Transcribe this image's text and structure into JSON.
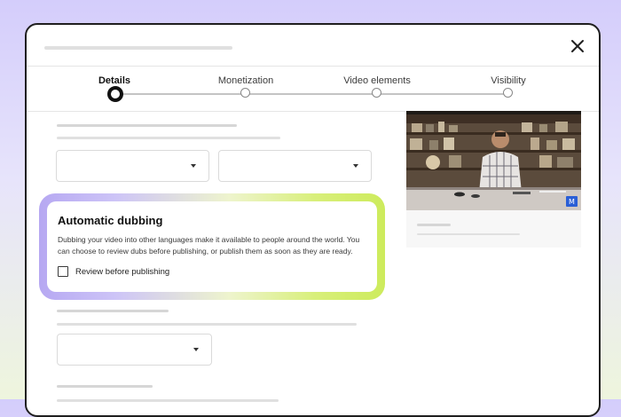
{
  "stepper": {
    "steps": [
      {
        "label": "Details",
        "active": true
      },
      {
        "label": "Monetization",
        "active": false
      },
      {
        "label": "Video elements",
        "active": false
      },
      {
        "label": "Visibility",
        "active": false
      }
    ]
  },
  "dubbing": {
    "title": "Automatic dubbing",
    "description": "Dubbing your video into other languages make it available to people around the world. You can choose to review dubs before publishing, or publish them as soon as they are ready.",
    "checkbox_label": "Review before publishing",
    "checkbox_checked": false
  },
  "icons": {
    "close": "close-icon",
    "dropdown": "chevron-down-icon",
    "checkbox": "checkbox-icon",
    "badge": "video-badge-icon"
  },
  "colors": {
    "accent_purple": "#b6a8f2",
    "accent_green": "#cdeb5c",
    "text_dark": "#111111"
  }
}
